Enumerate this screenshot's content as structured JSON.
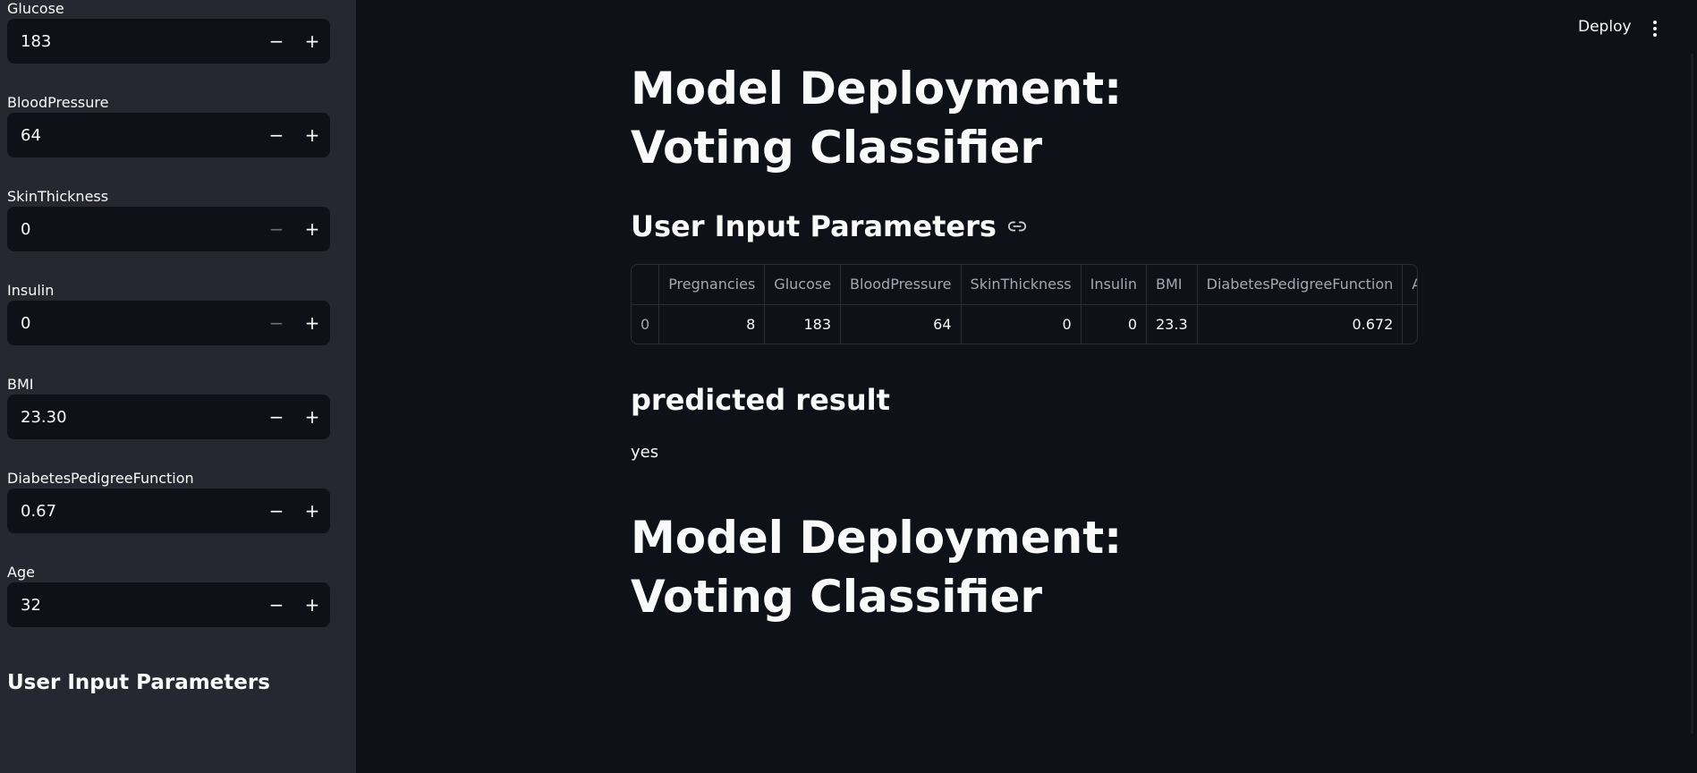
{
  "sidebar": {
    "fields": [
      {
        "label": "Glucose",
        "value": "183",
        "minus_enabled": true
      },
      {
        "label": "BloodPressure",
        "value": "64",
        "minus_enabled": true
      },
      {
        "label": "SkinThickness",
        "value": "0",
        "minus_enabled": false
      },
      {
        "label": "Insulin",
        "value": "0",
        "minus_enabled": false
      },
      {
        "label": "BMI",
        "value": "23.30",
        "minus_enabled": true
      },
      {
        "label": "DiabetesPedigreeFunction",
        "value": "0.67",
        "minus_enabled": true
      },
      {
        "label": "Age",
        "value": "32",
        "minus_enabled": true
      }
    ],
    "minus_symbol": "−",
    "plus_symbol": "+",
    "heading": "User Input Parameters"
  },
  "header": {
    "deploy_label": "Deploy",
    "menu_icon": "kebab-menu-icon"
  },
  "main": {
    "title": "Model Deployment: Voting Classifier",
    "subheading": "User Input Parameters",
    "link_icon": "link-icon",
    "table": {
      "columns": [
        "",
        "Pregnancies",
        "Glucose",
        "BloodPressure",
        "SkinThickness",
        "Insulin",
        "BMI",
        "DiabetesPedigreeFunction",
        "Ag"
      ],
      "rows": [
        [
          "0",
          "8",
          "183",
          "64",
          "0",
          "0",
          "23.3",
          "0.672",
          ""
        ]
      ]
    },
    "pred_heading": "predicted result",
    "pred_value": "yes",
    "title_repeat": "Model Deployment: Voting Classifier"
  },
  "colors": {
    "background": "#0e1117",
    "sidebar": "#262730",
    "text": "#fafafa"
  }
}
